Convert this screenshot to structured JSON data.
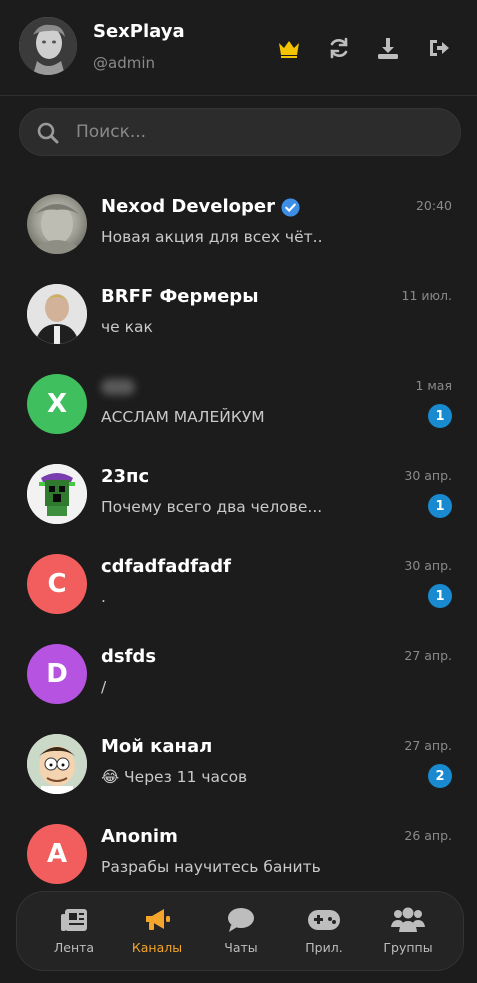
{
  "header": {
    "username": "SexPlaya",
    "handle": "@admin"
  },
  "search": {
    "placeholder": "Поиск..."
  },
  "chats": [
    {
      "name": "Nexod Developer",
      "message": "Новая акция для всех чёт...",
      "time": "20:40",
      "verified": true,
      "badge": ""
    },
    {
      "name": "BRFF Фермеры",
      "message": "че как",
      "time": "11 июл.",
      "badge": ""
    },
    {
      "name": "",
      "message": "АССЛАМ МАЛЕЙКУМ",
      "time": "1 мая",
      "badge": "1",
      "avatar_letter": "X"
    },
    {
      "name": "23пс",
      "message": "Почему всего два челове...",
      "time": "30 апр.",
      "badge": "1"
    },
    {
      "name": "cdfadfadfadf",
      "message": ".",
      "time": "30 апр.",
      "badge": "1",
      "avatar_letter": "C"
    },
    {
      "name": "dsfds",
      "message": "/",
      "time": "27 апр.",
      "badge": "",
      "avatar_letter": "D"
    },
    {
      "name": "Мой канал",
      "message": "😂 Через 11 часов",
      "time": "27 апр.",
      "badge": "2"
    },
    {
      "name": "Anonim",
      "message": "Разрабы научитесь банить",
      "time": "26 апр.",
      "badge": "",
      "avatar_letter": "A"
    }
  ],
  "nav": [
    {
      "label": "Лента"
    },
    {
      "label": "Каналы",
      "active": true
    },
    {
      "label": "Чаты"
    },
    {
      "label": "Прил."
    },
    {
      "label": "Группы"
    }
  ],
  "colors": {
    "accent": "#f4a52b",
    "badge": "#1a8ad0",
    "crown": "#f5c400"
  }
}
